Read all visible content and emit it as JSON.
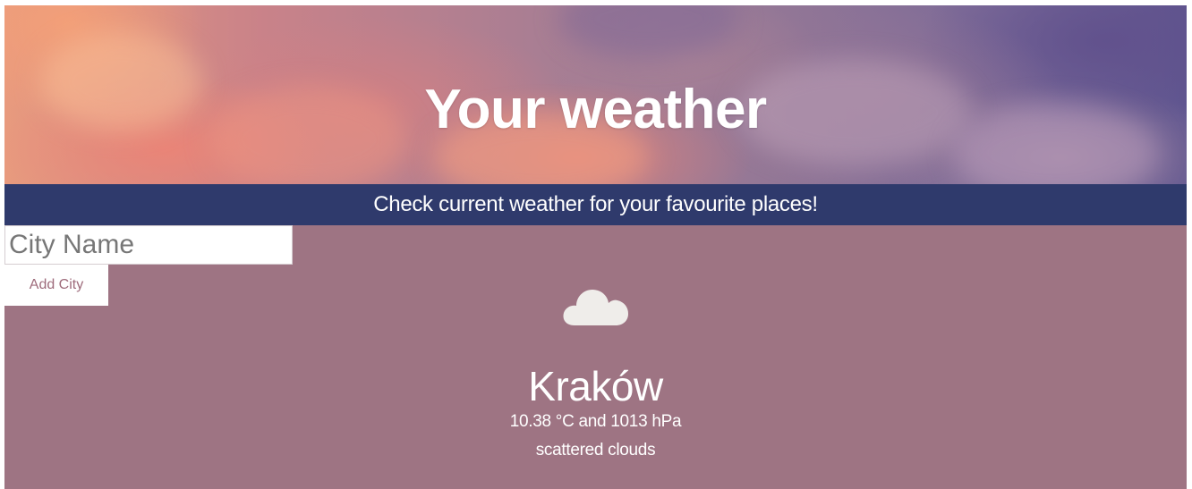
{
  "header": {
    "title": "Your weather",
    "background": "cloudy-sunset-sky-image"
  },
  "band": {
    "subtitle": "Check current weather for your favourite places!",
    "color": "#2f3a6c"
  },
  "form": {
    "city_input_placeholder": "City Name",
    "city_input_value": "",
    "add_button_label": "Add City"
  },
  "weather": {
    "icon": "cloud-icon",
    "city": "Kraków",
    "conditions": "10.38 °C and 1013 hPa",
    "description": "scattered clouds"
  },
  "colors": {
    "main_background": "#9e7483",
    "button_text": "#9e6b7b",
    "text": "#ffffff"
  }
}
